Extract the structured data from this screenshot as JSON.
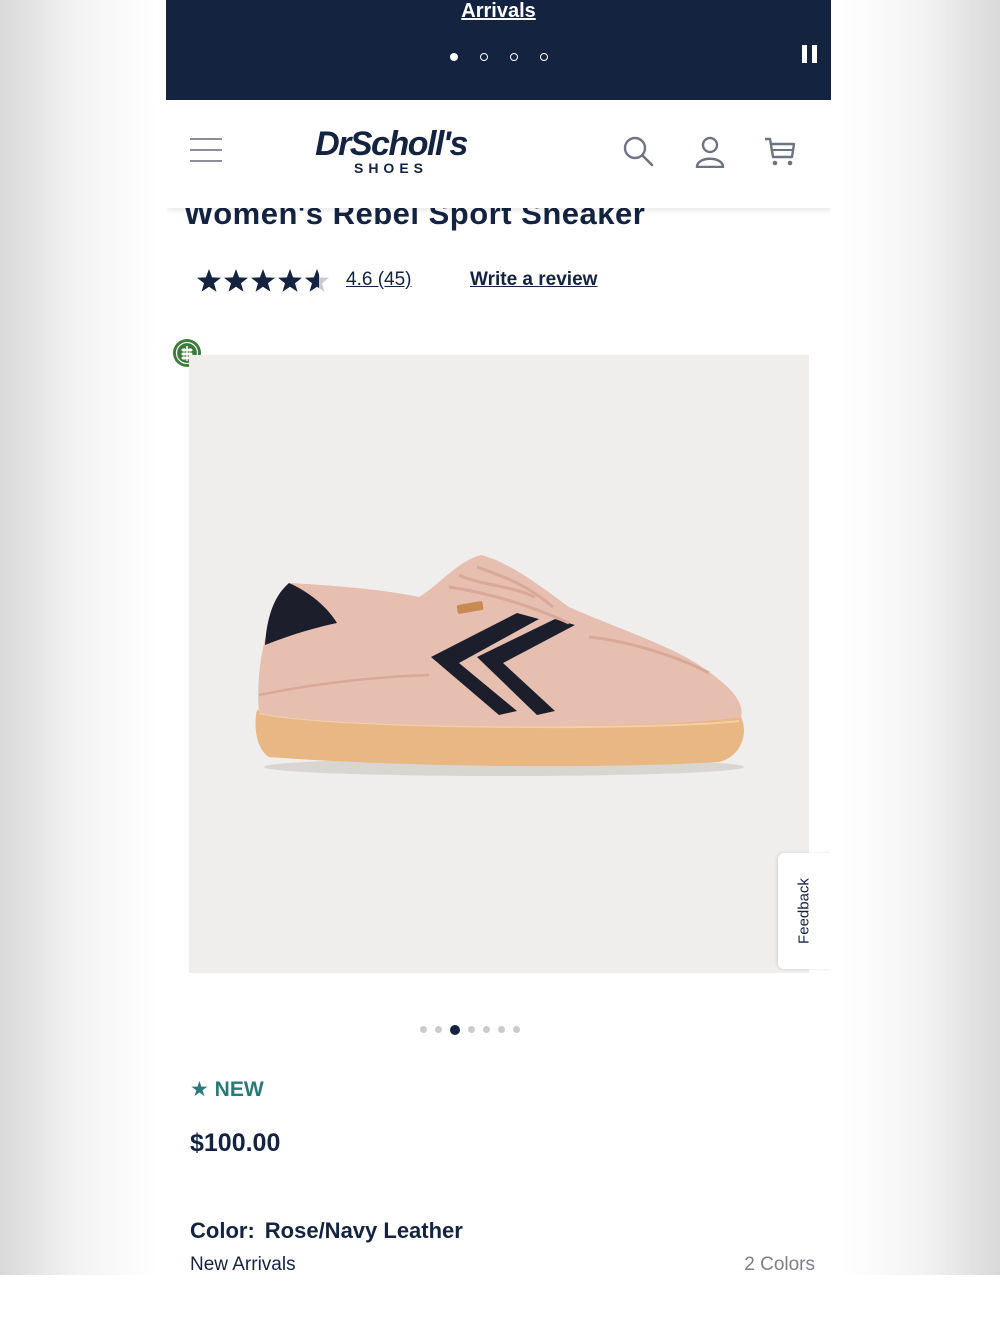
{
  "promo": {
    "text": "Arrivals",
    "dots": [
      true,
      false,
      false,
      false
    ]
  },
  "header": {
    "brand": "DrScholl's",
    "brand_sub": "SHOES"
  },
  "product": {
    "title": "Women's Rebel Sport Sneaker",
    "rating_value": 4.6,
    "rating_text": "4.6 (45)",
    "write_review": "Write a review",
    "badge": "★ NEW",
    "price": "$100.00",
    "color_label": "Color:",
    "color_value": "Rose/Navy Leather",
    "subcategory": "New Arrivals",
    "colors_count": "2 Colors"
  },
  "gallery": {
    "image_count": 7,
    "active_index": 2
  },
  "feedback_tab": "Feedback",
  "colors": {
    "navy": "#14233f",
    "teal": "#287a7a",
    "eco_green": "#3e7a3a",
    "image_bg": "#efeeec"
  },
  "icons": [
    "hamburger-menu-icon",
    "search-icon",
    "account-icon",
    "cart-icon",
    "pause-icon",
    "eco-leaf-icon",
    "star-icon"
  ]
}
